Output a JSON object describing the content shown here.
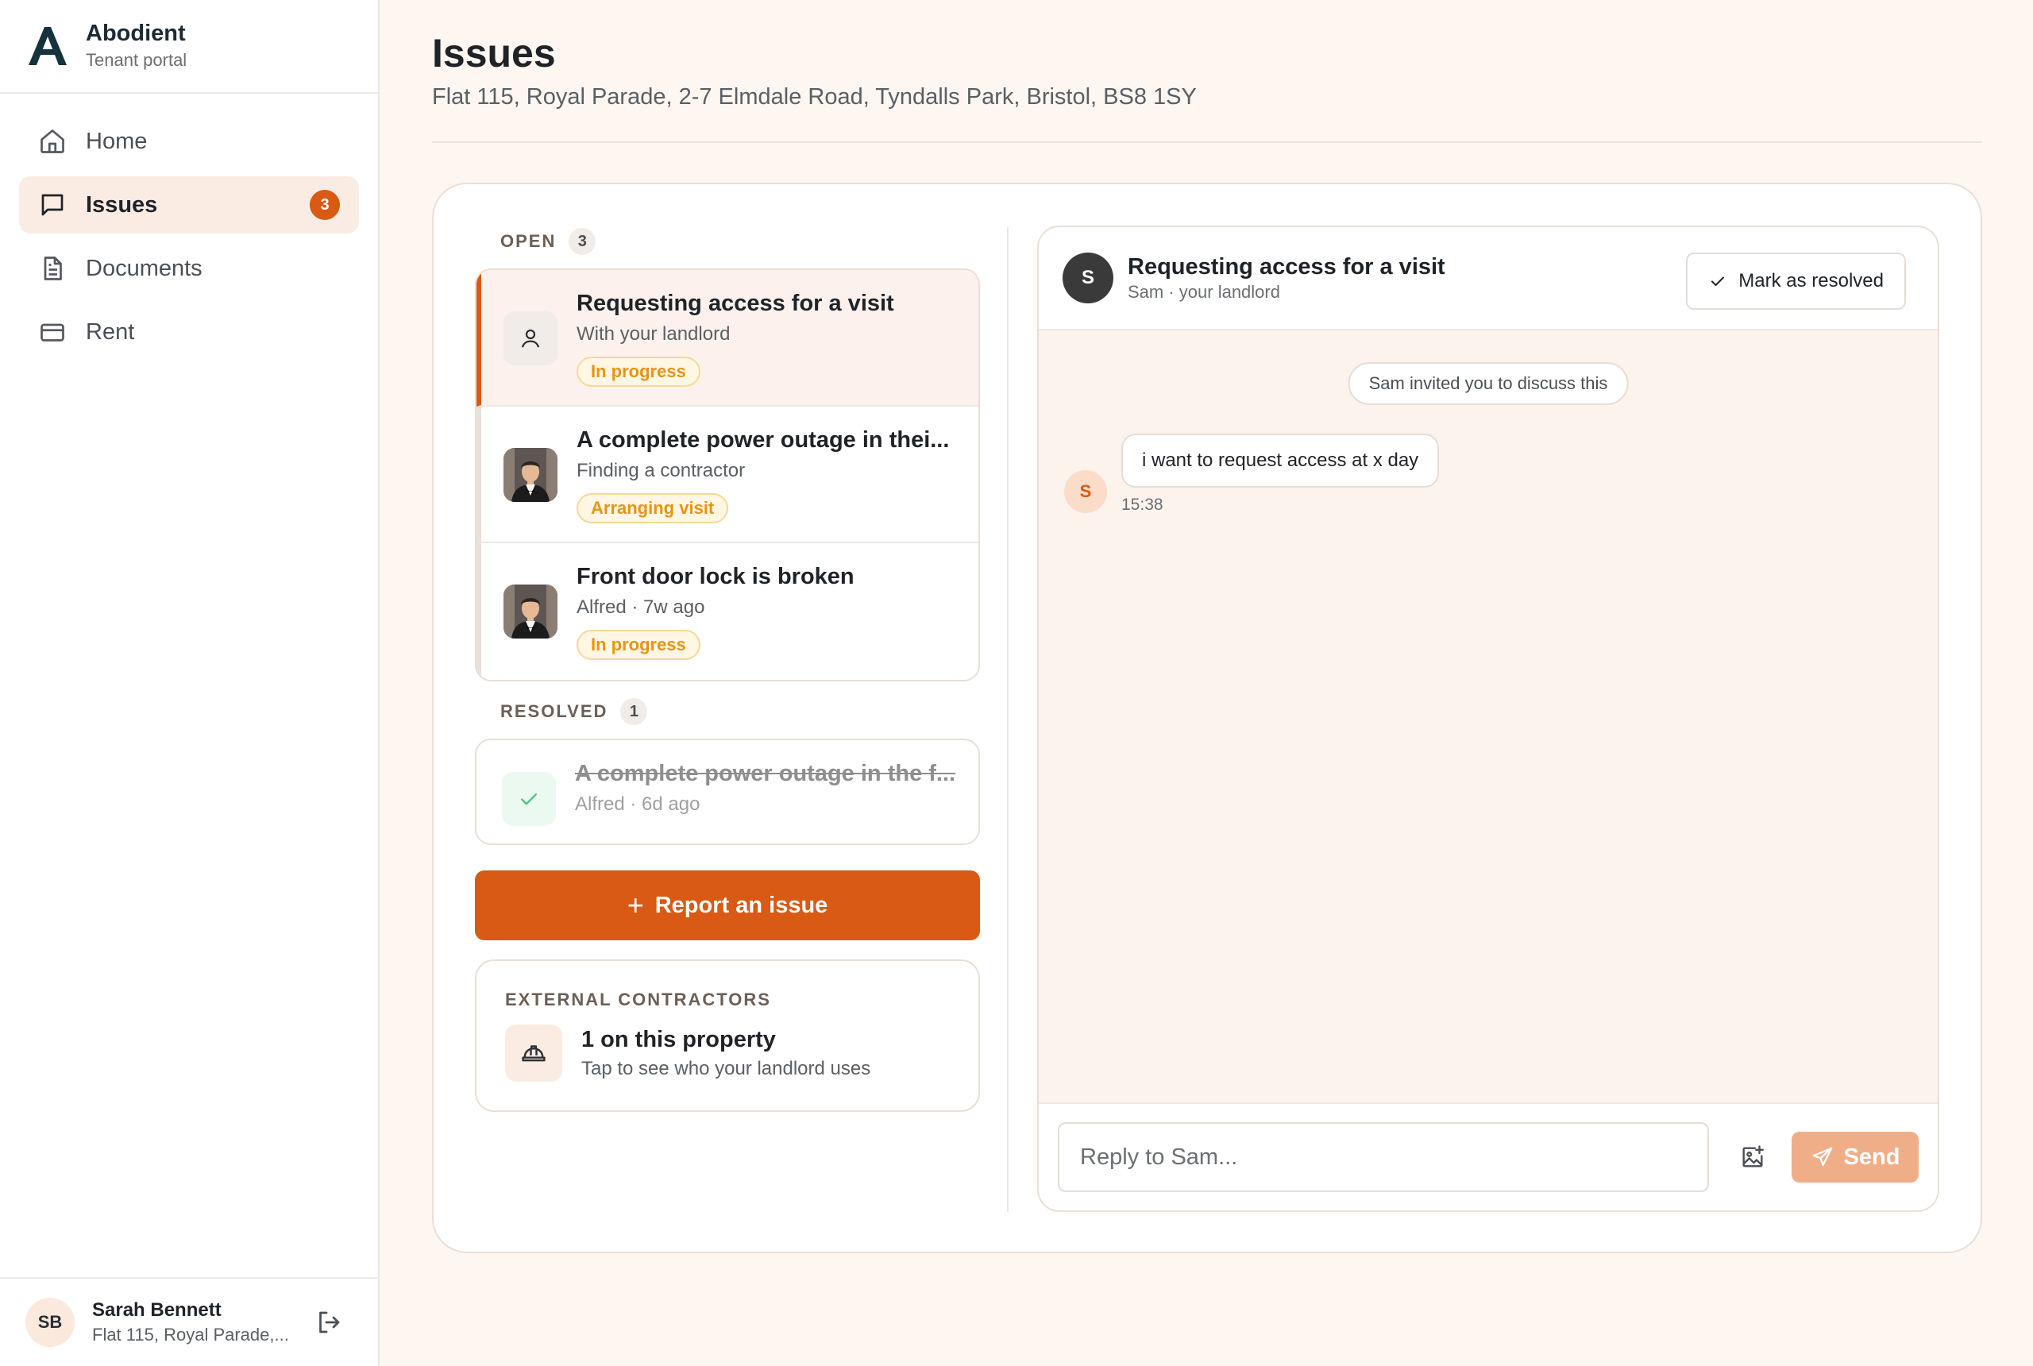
{
  "brand": {
    "name": "Abodient",
    "subtitle": "Tenant portal",
    "logo_icon": "abodient-logo"
  },
  "nav": {
    "items": [
      {
        "label": "Home",
        "icon": "home-icon",
        "active": false
      },
      {
        "label": "Issues",
        "icon": "message-icon",
        "active": true,
        "badge": "3"
      },
      {
        "label": "Documents",
        "icon": "document-icon",
        "active": false
      },
      {
        "label": "Rent",
        "icon": "card-icon",
        "active": false
      }
    ]
  },
  "user": {
    "initials": "SB",
    "name": "Sarah Bennett",
    "address": "Flat 115, Royal Parade,..."
  },
  "page": {
    "title": "Issues",
    "subtitle": "Flat 115, Royal Parade, 2-7 Elmdale Road, Tyndalls Park, Bristol, BS8 1SY"
  },
  "open": {
    "label": "OPEN",
    "count": "3",
    "issues": [
      {
        "title": "Requesting access for a visit",
        "subtitle": "With your landlord",
        "status": "In progress",
        "thumb": "person-icon"
      },
      {
        "title": "A complete power outage in thei...",
        "subtitle": "Finding a contractor",
        "status": "Arranging visit",
        "thumb": "contractor-avatar"
      },
      {
        "title": "Front door lock is broken",
        "subtitle": "Alfred · 7w ago",
        "status": "In progress",
        "thumb": "contractor-avatar"
      }
    ]
  },
  "resolved": {
    "label": "RESOLVED",
    "count": "1",
    "issues": [
      {
        "title": "A complete power outage in the f...",
        "subtitle": "Alfred · 6d ago",
        "thumb": "check-icon"
      }
    ]
  },
  "report_button": {
    "label": "Report an issue"
  },
  "contractors": {
    "label": "EXTERNAL CONTRACTORS",
    "title": "1 on this property",
    "subtitle": "Tap to see who your landlord uses",
    "icon": "hardhat-icon"
  },
  "chat": {
    "avatar": "S",
    "title": "Requesting access for a visit",
    "subtitle": "Sam · your landlord",
    "resolve_label": "Mark as resolved",
    "system_message": "Sam invited you to discuss this",
    "messages": [
      {
        "avatar": "S",
        "text": "i want to request access at x day",
        "time": "15:38"
      }
    ],
    "reply_placeholder": "Reply to Sam...",
    "send_label": "Send"
  },
  "colors": {
    "accent": "#d85a14",
    "status_text": "#e79413",
    "page_bg": "#fdf6f1",
    "send_disabled": "#f0ae88"
  }
}
